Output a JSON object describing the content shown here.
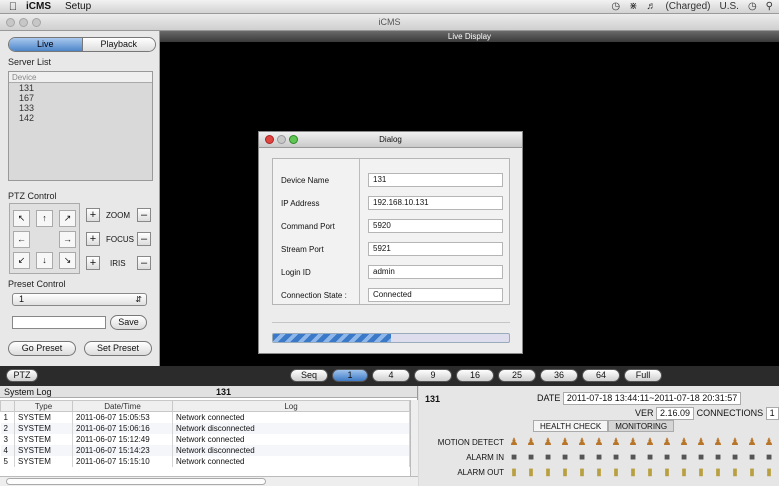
{
  "menubar": {
    "app": "iCMS",
    "menu": "Setup",
    "battery": "(Charged)",
    "input_source": "U.S."
  },
  "window": {
    "title": "iCMS"
  },
  "left": {
    "live_tab": "Live",
    "playback_tab": "Playback",
    "server_list_label": "Server List",
    "device_header": "Device",
    "devices": [
      "131",
      "167",
      "133",
      "142"
    ],
    "ptz_label": "PTZ Control",
    "zoom_label": "ZOOM",
    "focus_label": "FOCUS",
    "iris_label": "IRIS",
    "plus": "+",
    "minus": "–",
    "preset_label": "Preset Control",
    "preset_value": "1",
    "save_label": "Save",
    "go_preset_label": "Go Preset",
    "set_preset_label": "Set Preset"
  },
  "video": {
    "header": "Live Display"
  },
  "dialog": {
    "title": "Dialog",
    "fields": [
      {
        "label": "Device Name",
        "value": "131"
      },
      {
        "label": "IP Address",
        "value": "192.168.10.131"
      },
      {
        "label": "Command Port",
        "value": "5920"
      },
      {
        "label": "Stream Port",
        "value": "5921"
      },
      {
        "label": "Login ID",
        "value": "admin"
      },
      {
        "label": "Connection State :",
        "value": "Connected"
      }
    ],
    "progress": 0.5
  },
  "toolbar": {
    "ptz_label": "PTZ",
    "seq_label": "Seq",
    "layouts": [
      "1",
      "4",
      "9",
      "16",
      "25",
      "36",
      "64",
      "Full"
    ],
    "active_layout": "1"
  },
  "syslog": {
    "title": "System Log",
    "count": "131",
    "columns": [
      "Type",
      "Date/Time",
      "Log"
    ],
    "rows": [
      {
        "n": "1",
        "type": "SYSTEM",
        "time": "2011-06-07 15:05:53",
        "log": "Network connected"
      },
      {
        "n": "2",
        "type": "SYSTEM",
        "time": "2011-06-07 15:06:16",
        "log": "Network disconnected"
      },
      {
        "n": "3",
        "type": "SYSTEM",
        "time": "2011-06-07 15:12:49",
        "log": "Network connected"
      },
      {
        "n": "4",
        "type": "SYSTEM",
        "time": "2011-06-07 15:14:23",
        "log": "Network disconnected"
      },
      {
        "n": "5",
        "type": "SYSTEM",
        "time": "2011-06-07 15:15:10",
        "log": "Network connected"
      }
    ]
  },
  "status": {
    "device": "131",
    "date_label": "DATE",
    "date_value": "2011-07-18 13:44:11~2011-07-18 20:31:57",
    "ver_label": "VER",
    "ver_value": "2.16.09",
    "connections_label": "CONNECTIONS",
    "connections_value": "1",
    "tab_health": "HEALTH CHECK",
    "tab_monitoring": "MONITORING",
    "motion_label": "MOTION DETECT",
    "alarm_in_label": "ALARM IN",
    "alarm_out_label": "ALARM OUT"
  }
}
